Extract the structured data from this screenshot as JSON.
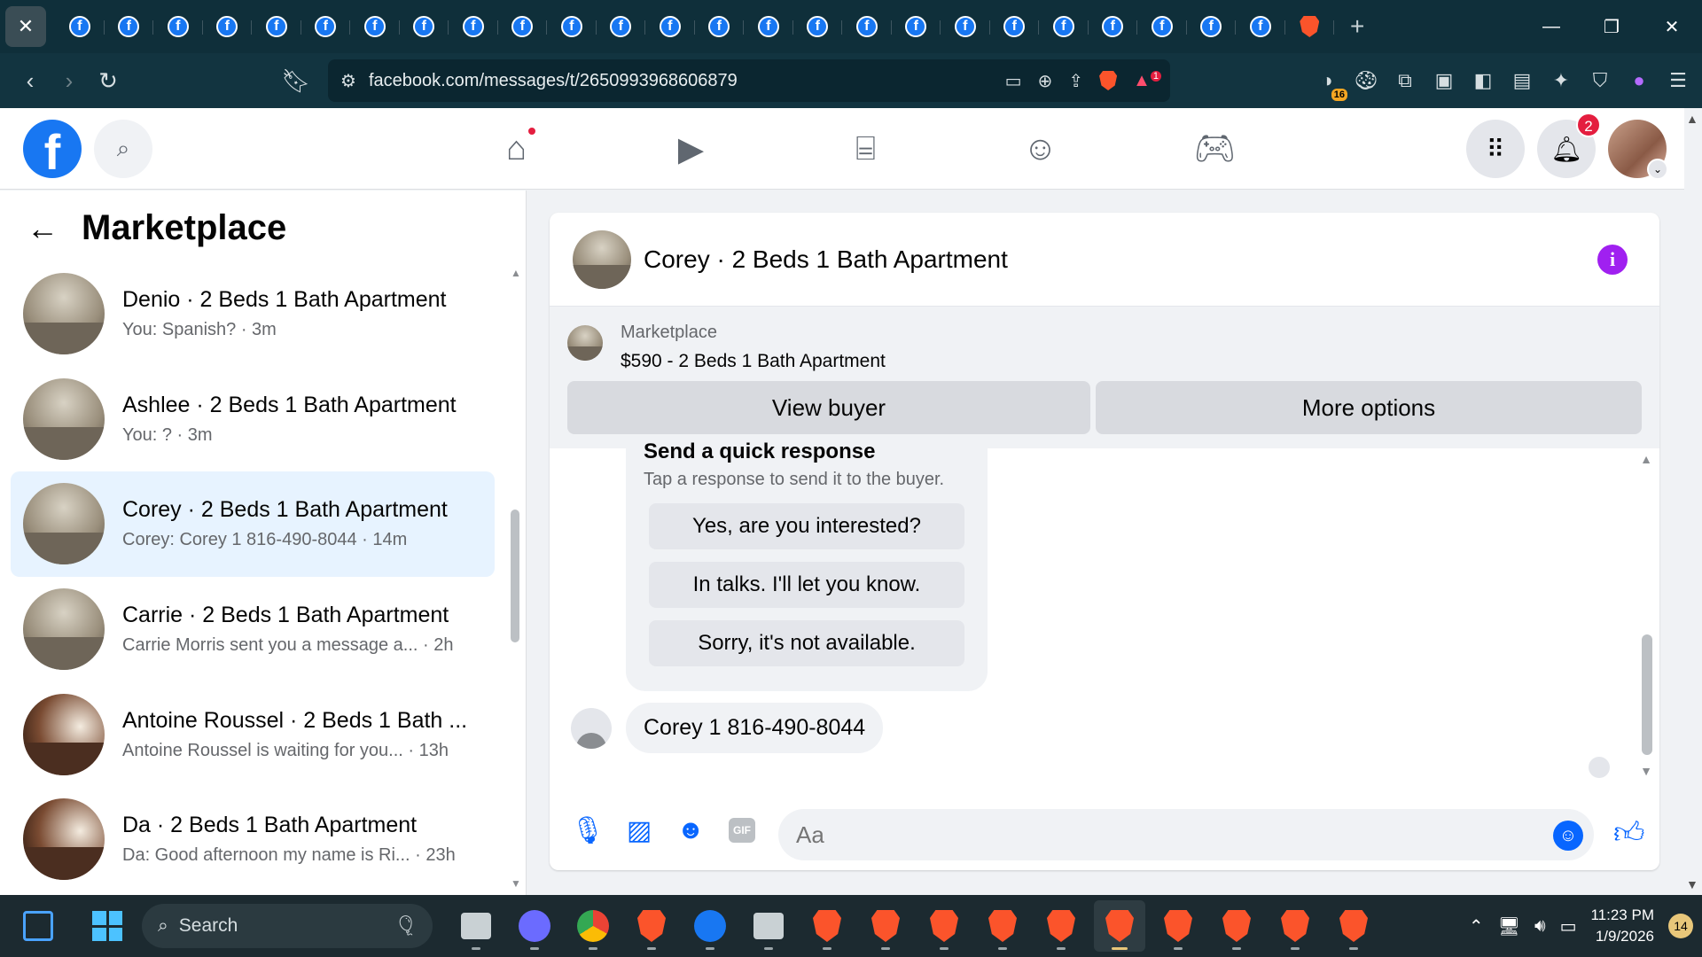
{
  "browser": {
    "tabs": {
      "favicons": [
        "facebook-icon",
        "facebook-icon",
        "facebook-icon",
        "facebook-icon",
        "facebook-icon",
        "facebook-icon",
        "facebook-icon",
        "facebook-icon",
        "facebook-icon",
        "facebook-icon",
        "facebook-icon",
        "facebook-icon",
        "facebook-icon",
        "facebook-icon",
        "facebook-icon",
        "facebook-icon",
        "facebook-icon",
        "facebook-icon",
        "facebook-icon",
        "facebook-icon",
        "facebook-icon",
        "facebook-icon",
        "facebook-icon",
        "facebook-icon",
        "facebook-icon",
        "brave-icon"
      ]
    },
    "address": {
      "url": "facebook.com/messages/t/2650993968606879"
    },
    "extensions": {
      "badge_count": "16",
      "alert_count": "1"
    }
  },
  "fb": {
    "logo": "f",
    "notifications_count": "2"
  },
  "left_panel": {
    "title": "Marketplace",
    "chats": [
      {
        "name": "Denio · 2 Beds 1 Bath Apartment",
        "preview": "You: Spanish? · 3m",
        "active": false,
        "thumb": "room"
      },
      {
        "name": "Ashlee · 2 Beds 1 Bath Apartment",
        "preview": "You: ? · 3m",
        "active": false,
        "thumb": "room"
      },
      {
        "name": "Corey · 2 Beds 1 Bath Apartment",
        "preview": "Corey: Corey 1 816-490-8044 · 14m",
        "active": true,
        "thumb": "room"
      },
      {
        "name": "Carrie · 2 Beds 1 Bath Apartment",
        "preview": "Carrie Morris sent you a message a...  · 2h",
        "active": false,
        "thumb": "room"
      },
      {
        "name": "Antoine Roussel · 2 Beds 1 Bath ...",
        "preview": "Antoine Roussel is waiting for you...  · 13h",
        "active": false,
        "thumb": "dark"
      },
      {
        "name": "Da · 2 Beds 1 Bath Apartment",
        "preview": "Da: Good afternoon my name is Ri...  · 23h",
        "active": false,
        "thumb": "dark"
      }
    ]
  },
  "conversation": {
    "title": "Corey · 2 Beds 1 Bath Apartment",
    "banner": {
      "label": "Marketplace",
      "listing": "$590 - 2 Beds 1 Bath Apartment",
      "view_buyer": "View buyer",
      "more_options": "More options"
    },
    "quick_response": {
      "title": "Send a quick response",
      "subtitle": "Tap a response to send it to the buyer.",
      "options": [
        "Yes, are you interested?",
        "In talks. I'll let you know.",
        "Sorry, it's not available."
      ]
    },
    "message": "Corey 1 816-490-8044",
    "composer": {
      "placeholder": "Aa"
    }
  },
  "taskbar": {
    "search_label": "Search",
    "time": "11:23 PM",
    "date": "1/9/2026",
    "notification_count": "14"
  },
  "colors": {
    "fb_blue": "#1877f2",
    "messenger_blue": "#0866ff",
    "active_chat_bg": "#e7f3ff",
    "info_purple": "#a020f0",
    "alert_red": "#e41e3f"
  }
}
